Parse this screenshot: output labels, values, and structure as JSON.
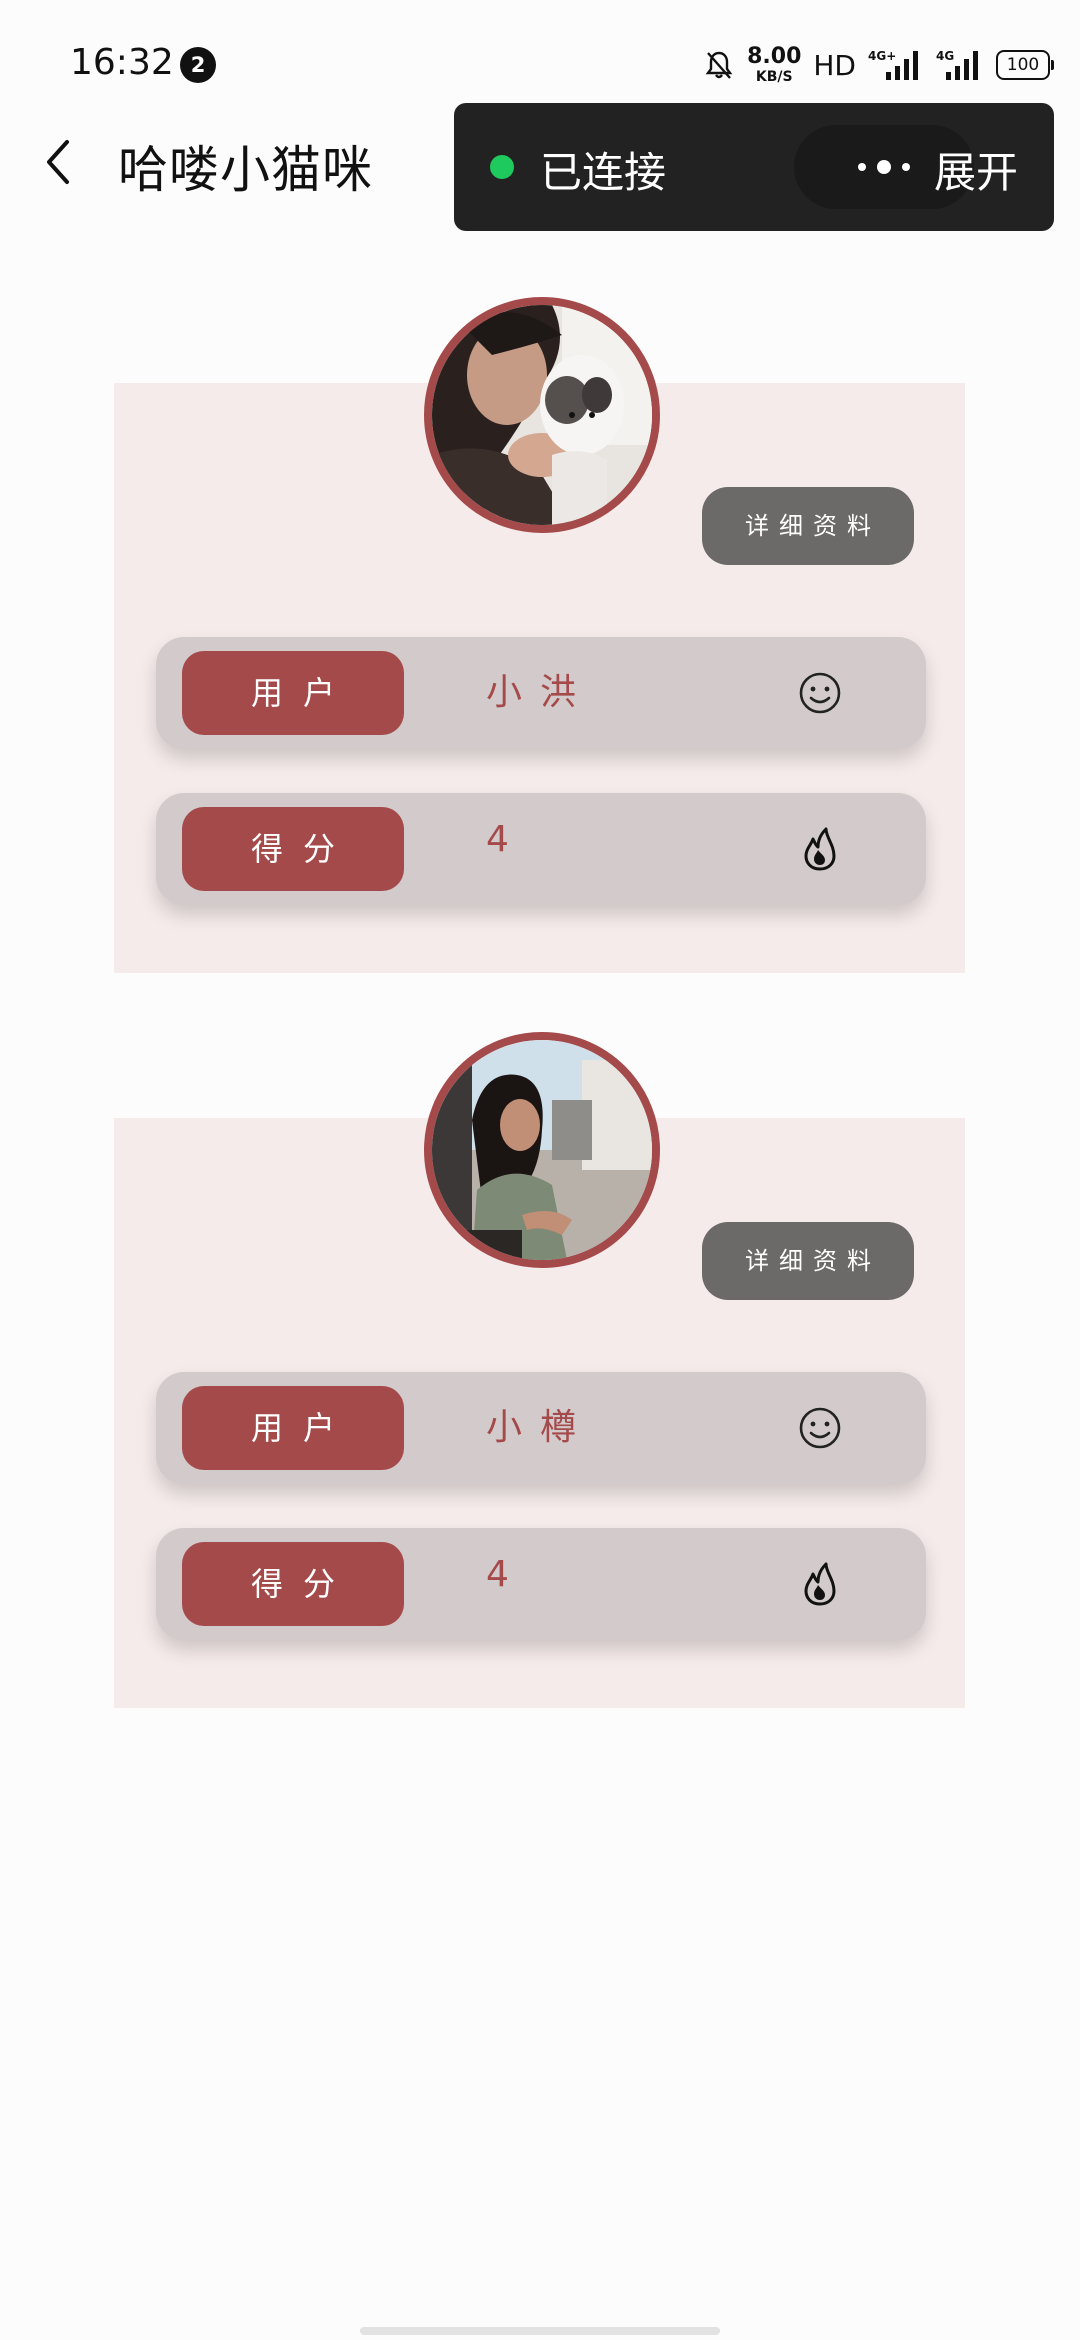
{
  "status_bar": {
    "time": "16:32",
    "notification_count": "2",
    "net_speed_value": "8.00",
    "net_speed_unit": "KB/S",
    "hd_label": "HD",
    "battery": "100"
  },
  "header": {
    "title": "哈喽小猫咪",
    "back_icon": "chevron-left-icon"
  },
  "connection": {
    "status": "已连接",
    "status_color": "#1ec95d",
    "expand_label": "展开"
  },
  "cards": [
    {
      "avatar": "woman-holding-cat-photo",
      "detail_label": "详细资料",
      "user_label": "用户",
      "user_name": "小洪",
      "user_icon": "smiley-icon",
      "score_label": "得分",
      "score": "4",
      "score_icon": "flame-icon"
    },
    {
      "avatar": "woman-outdoor-photo",
      "detail_label": "详细资料",
      "user_label": "用户",
      "user_name": "小樽",
      "user_icon": "smiley-icon",
      "score_label": "得分",
      "score": "4",
      "score_icon": "flame-icon"
    }
  ],
  "colors": {
    "accent": "#a54a4a",
    "card_bg": "#f5ebea",
    "row_bg": "#d3cbcb",
    "detail_button_bg": "#6b6a69"
  }
}
